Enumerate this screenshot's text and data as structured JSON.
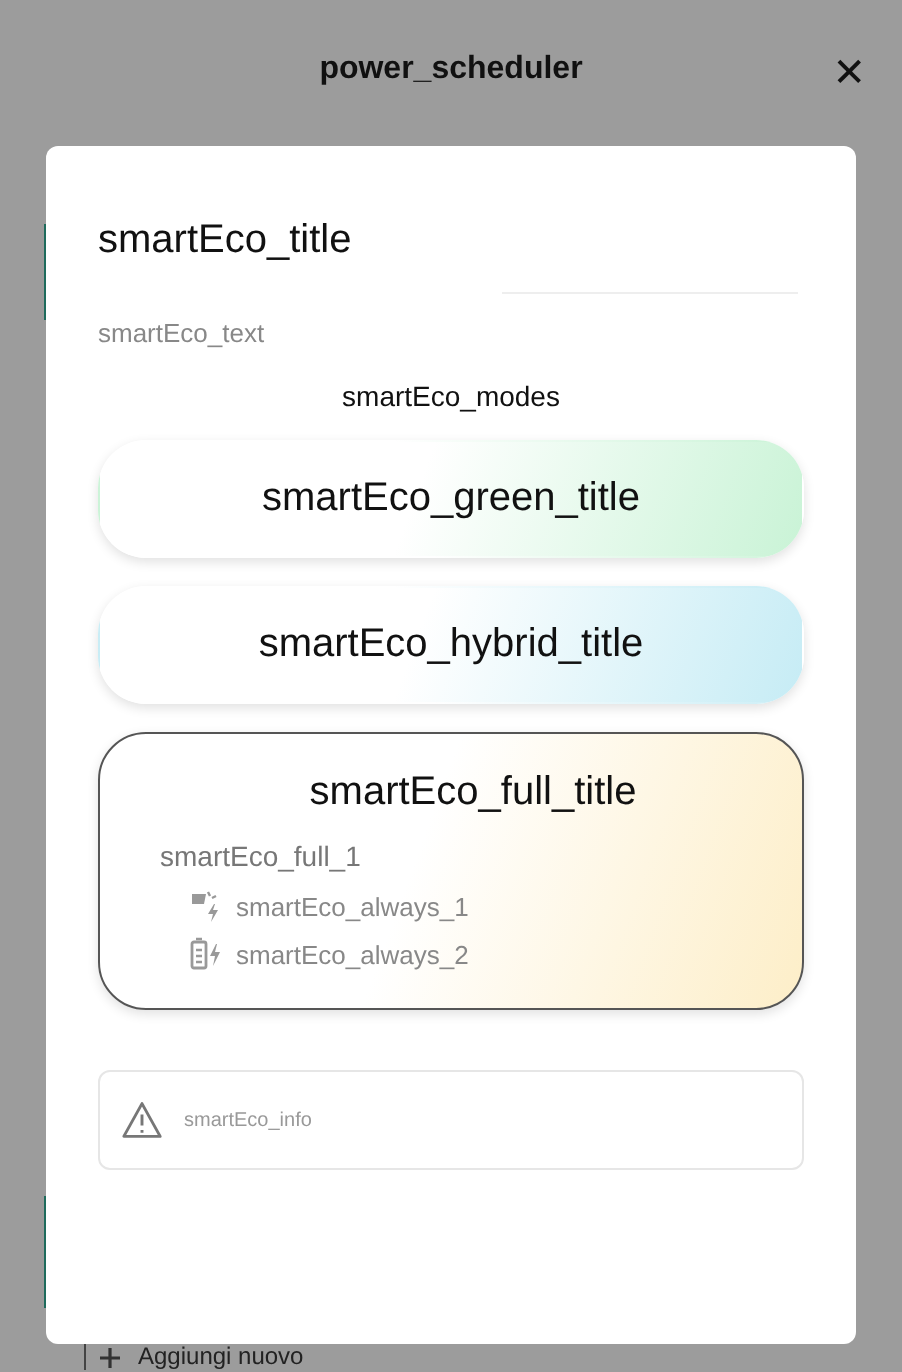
{
  "header": {
    "title": "power_scheduler",
    "close": "✕"
  },
  "modal": {
    "title": "smartEco_title",
    "text": "smartEco_text",
    "modes_label": "smartEco_modes",
    "modes": [
      {
        "title": "smartEco_green_title",
        "selected": false,
        "color": "#c9f3d6"
      },
      {
        "title": "smartEco_hybrid_title",
        "selected": false,
        "color": "#c6ecf5"
      },
      {
        "title": "smartEco_full_title",
        "selected": true,
        "color": "#fdeec8",
        "description": "smartEco_full_1",
        "features": [
          {
            "kind": "solar",
            "text": "smartEco_always_1"
          },
          {
            "kind": "battery",
            "text": "smartEco_always_2"
          }
        ]
      }
    ],
    "info": "smartEco_info"
  },
  "behind": {
    "add_label": "Aggiungi nuovo"
  }
}
